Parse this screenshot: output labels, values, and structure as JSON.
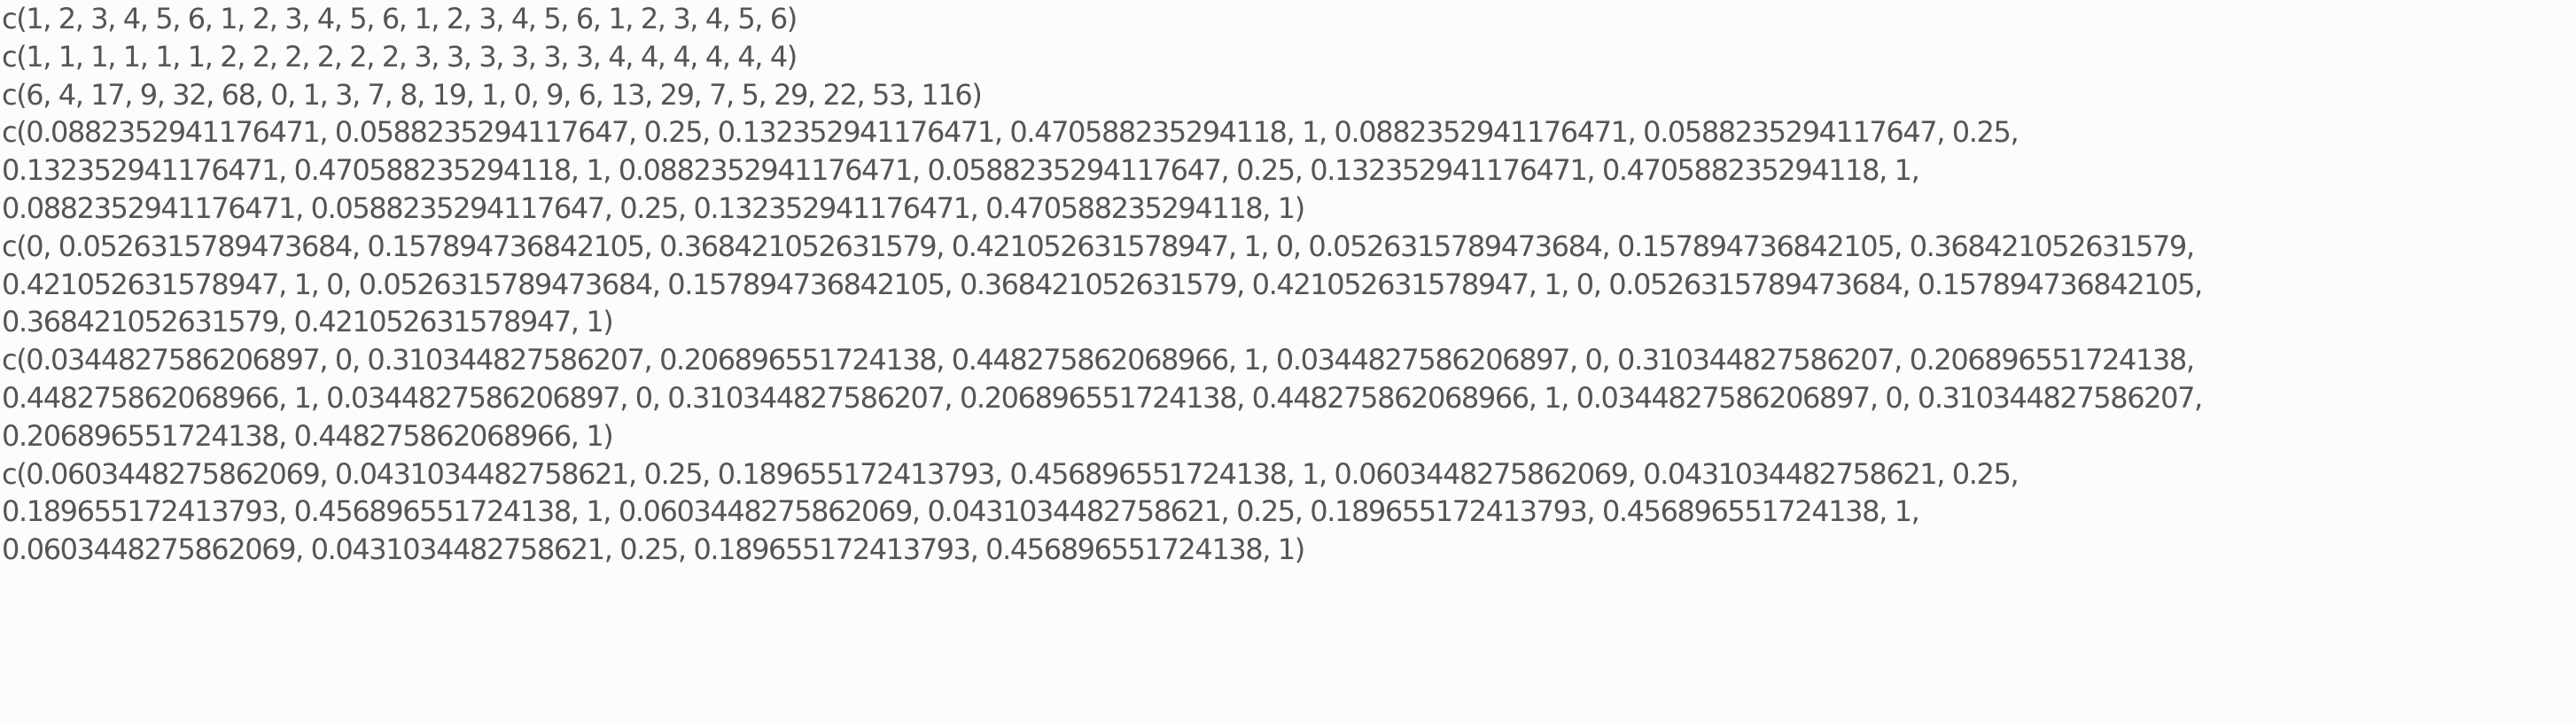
{
  "lines": [
    "c(1, 2, 3, 4, 5, 6, 1, 2, 3, 4, 5, 6, 1, 2, 3, 4, 5, 6, 1, 2, 3, 4, 5, 6)",
    "c(1, 1, 1, 1, 1, 1, 2, 2, 2, 2, 2, 2, 3, 3, 3, 3, 3, 3, 4, 4, 4, 4, 4, 4)",
    "c(6, 4, 17, 9, 32, 68, 0, 1, 3, 7, 8, 19, 1, 0, 9, 6, 13, 29, 7, 5, 29, 22, 53, 116)",
    "c(0.0882352941176471, 0.0588235294117647, 0.25, 0.132352941176471, 0.470588235294118, 1, 0.0882352941176471, 0.0588235294117647, 0.25,",
    "0.132352941176471, 0.470588235294118, 1, 0.0882352941176471, 0.0588235294117647, 0.25, 0.132352941176471, 0.470588235294118, 1,",
    "0.0882352941176471, 0.0588235294117647, 0.25, 0.132352941176471, 0.470588235294118, 1)",
    "c(0, 0.0526315789473684, 0.157894736842105, 0.368421052631579, 0.421052631578947, 1, 0, 0.0526315789473684, 0.157894736842105, 0.368421052631579,",
    "0.421052631578947, 1, 0, 0.0526315789473684, 0.157894736842105, 0.368421052631579, 0.421052631578947, 1, 0, 0.0526315789473684, 0.157894736842105,",
    "0.368421052631579, 0.421052631578947, 1)",
    "c(0.0344827586206897, 0, 0.310344827586207, 0.206896551724138, 0.448275862068966, 1, 0.0344827586206897, 0, 0.310344827586207, 0.206896551724138,",
    "0.448275862068966, 1, 0.0344827586206897, 0, 0.310344827586207, 0.206896551724138, 0.448275862068966, 1, 0.0344827586206897, 0, 0.310344827586207,",
    "0.206896551724138, 0.448275862068966, 1)",
    "c(0.0603448275862069, 0.0431034482758621, 0.25, 0.189655172413793, 0.456896551724138, 1, 0.0603448275862069, 0.0431034482758621, 0.25,",
    "0.189655172413793, 0.456896551724138, 1, 0.0603448275862069, 0.0431034482758621, 0.25, 0.189655172413793, 0.456896551724138, 1,",
    "0.0603448275862069, 0.0431034482758621, 0.25, 0.189655172413793, 0.456896551724138, 1)"
  ]
}
